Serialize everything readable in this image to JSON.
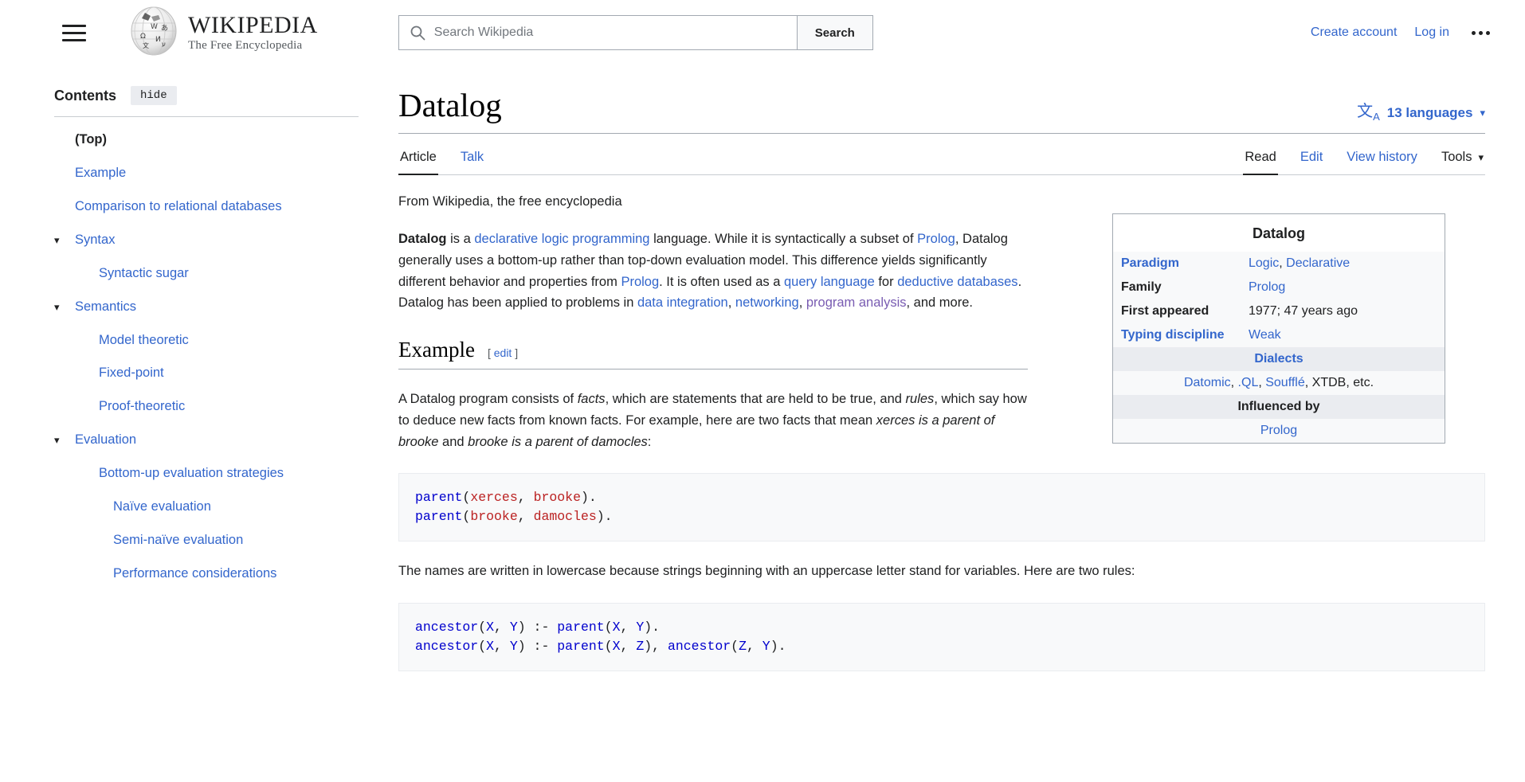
{
  "header": {
    "menu_icon": "hamburger-icon",
    "logo_title": "WIKIPEDIA",
    "logo_tagline": "The Free Encyclopedia",
    "search_placeholder": "Search Wikipedia",
    "search_value": "",
    "search_button": "Search",
    "create_account": "Create account",
    "log_in": "Log in",
    "more_icon": "ellipsis-icon"
  },
  "toc": {
    "title": "Contents",
    "hide_label": "hide",
    "items": [
      {
        "label": "(Top)",
        "level": 1,
        "chevron": false,
        "current": true
      },
      {
        "label": "Example",
        "level": 1,
        "chevron": false,
        "current": false
      },
      {
        "label": "Comparison to relational databases",
        "level": 1,
        "chevron": false,
        "current": false
      },
      {
        "label": "Syntax",
        "level": 1,
        "chevron": true,
        "current": false
      },
      {
        "label": "Syntactic sugar",
        "level": 2,
        "chevron": false,
        "current": false
      },
      {
        "label": "Semantics",
        "level": 1,
        "chevron": true,
        "current": false
      },
      {
        "label": "Model theoretic",
        "level": 2,
        "chevron": false,
        "current": false
      },
      {
        "label": "Fixed-point",
        "level": 2,
        "chevron": false,
        "current": false
      },
      {
        "label": "Proof-theoretic",
        "level": 2,
        "chevron": false,
        "current": false
      },
      {
        "label": "Evaluation",
        "level": 1,
        "chevron": true,
        "current": false
      },
      {
        "label": "Bottom-up evaluation strategies",
        "level": 2,
        "chevron": false,
        "current": false
      },
      {
        "label": "Naïve evaluation",
        "level": 3,
        "chevron": false,
        "current": false
      },
      {
        "label": "Semi-naïve evaluation",
        "level": 3,
        "chevron": false,
        "current": false
      },
      {
        "label": "Performance considerations",
        "level": 3,
        "chevron": false,
        "current": false
      }
    ]
  },
  "article": {
    "title": "Datalog",
    "languages_label": "13 languages",
    "languages_icon": "language-icon",
    "tabs_left": [
      {
        "label": "Article",
        "active": true
      },
      {
        "label": "Talk",
        "active": false
      }
    ],
    "tabs_right": [
      {
        "label": "Read",
        "active": true
      },
      {
        "label": "Edit",
        "active": false
      },
      {
        "label": "View history",
        "active": false
      }
    ],
    "tools_label": "Tools",
    "from_line": "From Wikipedia, the free encyclopedia",
    "lead": {
      "t1": "Datalog",
      "t2": " is a ",
      "l1": "declarative logic programming",
      "t3": " language. While it is syntactically a subset of ",
      "l2": "Prolog",
      "t4": ", Datalog generally uses a bottom-up rather than top-down evaluation model. This difference yields significantly different behavior and properties from ",
      "l3": "Prolog",
      "t5": ". It is often used as a ",
      "l4": "query language",
      "t6": " for ",
      "l5": "deductive databases",
      "t7": ". Datalog has been applied to problems in ",
      "l6": "data integration",
      "t8": ", ",
      "l7": "networking",
      "t9": ", ",
      "l8": "program analysis",
      "t10": ", and more."
    },
    "example_heading": "Example",
    "edit_bracket_open": "[ ",
    "edit_label": "edit",
    "edit_bracket_close": " ]",
    "example_para": {
      "p1": "A Datalog program consists of ",
      "i1": "facts",
      "p2": ", which are statements that are held to be true, and ",
      "i2": "rules",
      "p3": ", which say how to deduce new facts from known facts. For example, here are two facts that mean ",
      "i3": "xerces is a parent of brooke",
      "p4": " and ",
      "i4": "brooke is a parent of damocles",
      "p5": ":"
    },
    "code_facts": [
      {
        "fn": "parent",
        "open": "(",
        "args": [
          "xerces",
          "brooke"
        ],
        "close": ")."
      },
      {
        "fn": "parent",
        "open": "(",
        "args": [
          "brooke",
          "damocles"
        ],
        "close": ")."
      }
    ],
    "code_facts_text": "parent(xerces, brooke).\nparent(brooke, damocles).",
    "rules_para": "The names are written in lowercase because strings beginning with an uppercase letter stand for variables. Here are two rules:",
    "code_rules_text": "ancestor(X, Y) :- parent(X, Y).\nancestor(X, Y) :- parent(X, Z), ancestor(Z, Y)."
  },
  "infobox": {
    "title": "Datalog",
    "rows": [
      {
        "label": "Paradigm",
        "label_link": true,
        "values": [
          "Logic",
          "Declarative"
        ],
        "value_links": [
          true,
          true
        ],
        "separator": ", "
      },
      {
        "label": "Family",
        "label_link": false,
        "values": [
          "Prolog"
        ],
        "value_links": [
          true
        ],
        "separator": ""
      },
      {
        "label": "First appeared",
        "label_link": false,
        "values": [
          "1977; 47 years ago"
        ],
        "value_links": [
          false
        ],
        "separator": ""
      },
      {
        "label": "Typing discipline",
        "label_link": true,
        "values": [
          "Weak"
        ],
        "value_links": [
          true
        ],
        "separator": ""
      }
    ],
    "dialects_heading": "Dialects",
    "dialects_values": "Datomic, .QL, Soufflé, XTDB, etc.",
    "influenced_heading": "Influenced by",
    "influenced_values": "Prolog"
  },
  "colors": {
    "link": "#3366cc",
    "visited_link": "#795cb2",
    "text": "#202122",
    "infobox_bg": "#f8f9fa",
    "code_fn": "#0000cd",
    "code_atom": "#bb2222"
  }
}
